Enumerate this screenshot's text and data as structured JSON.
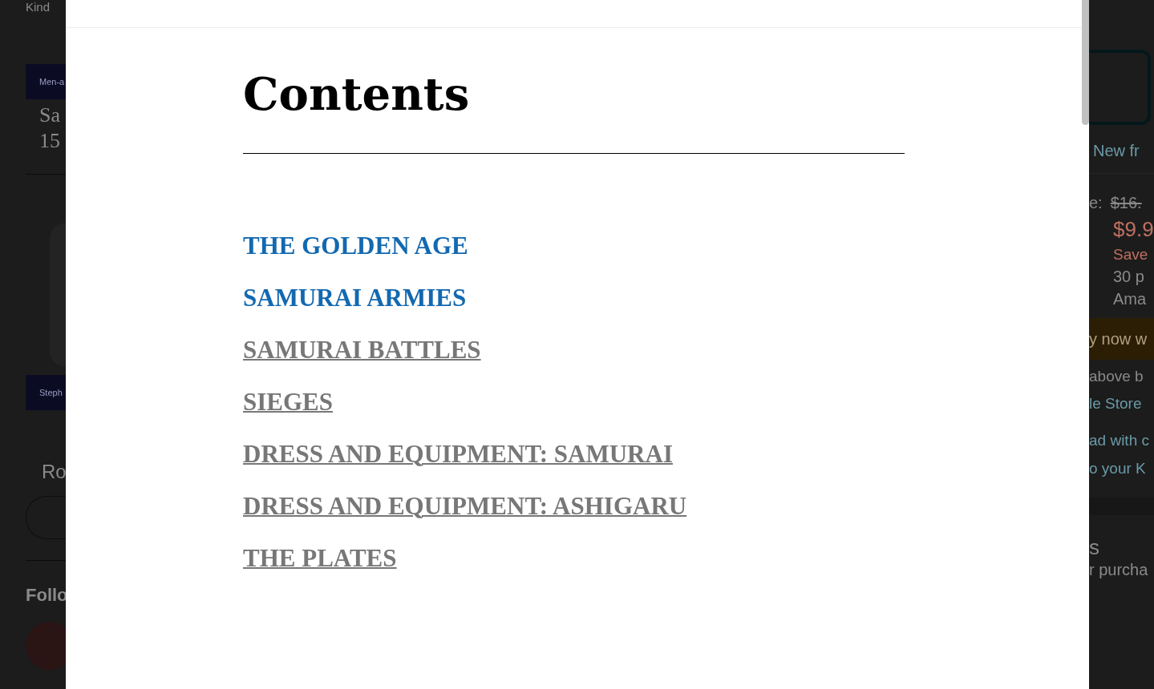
{
  "background_page": {
    "left": {
      "top_text": "Kind",
      "series_badge": "Men-a",
      "title_lines": [
        "Sa",
        "15"
      ],
      "author_badge": "Steph",
      "section_text": "Ro",
      "follow_heading": "Follo"
    },
    "right": {
      "format_option": "New fr",
      "price_label": "e:",
      "list_price": "$16.",
      "price": "$9.9",
      "savings": "Save",
      "points": "30 p",
      "seller": "Ama",
      "buy_button": "y now w",
      "notes": [
        "above b",
        "le Store"
      ],
      "read_notes": [
        "ad with c",
        "o your K"
      ],
      "section_heading": "s",
      "section_text": "r purcha"
    }
  },
  "dialog": {
    "heading": "Contents",
    "entries": [
      {
        "label": "THE GOLDEN AGE",
        "visited": false
      },
      {
        "label": "SAMURAI ARMIES",
        "visited": false
      },
      {
        "label": "SAMURAI BATTLES",
        "visited": true
      },
      {
        "label": "SIEGES",
        "visited": true
      },
      {
        "label": "DRESS AND EQUIPMENT: SAMURAI",
        "visited": true
      },
      {
        "label": "DRESS AND EQUIPMENT: ASHIGARU",
        "visited": true
      },
      {
        "label": "THE PLATES",
        "visited": true
      }
    ]
  }
}
